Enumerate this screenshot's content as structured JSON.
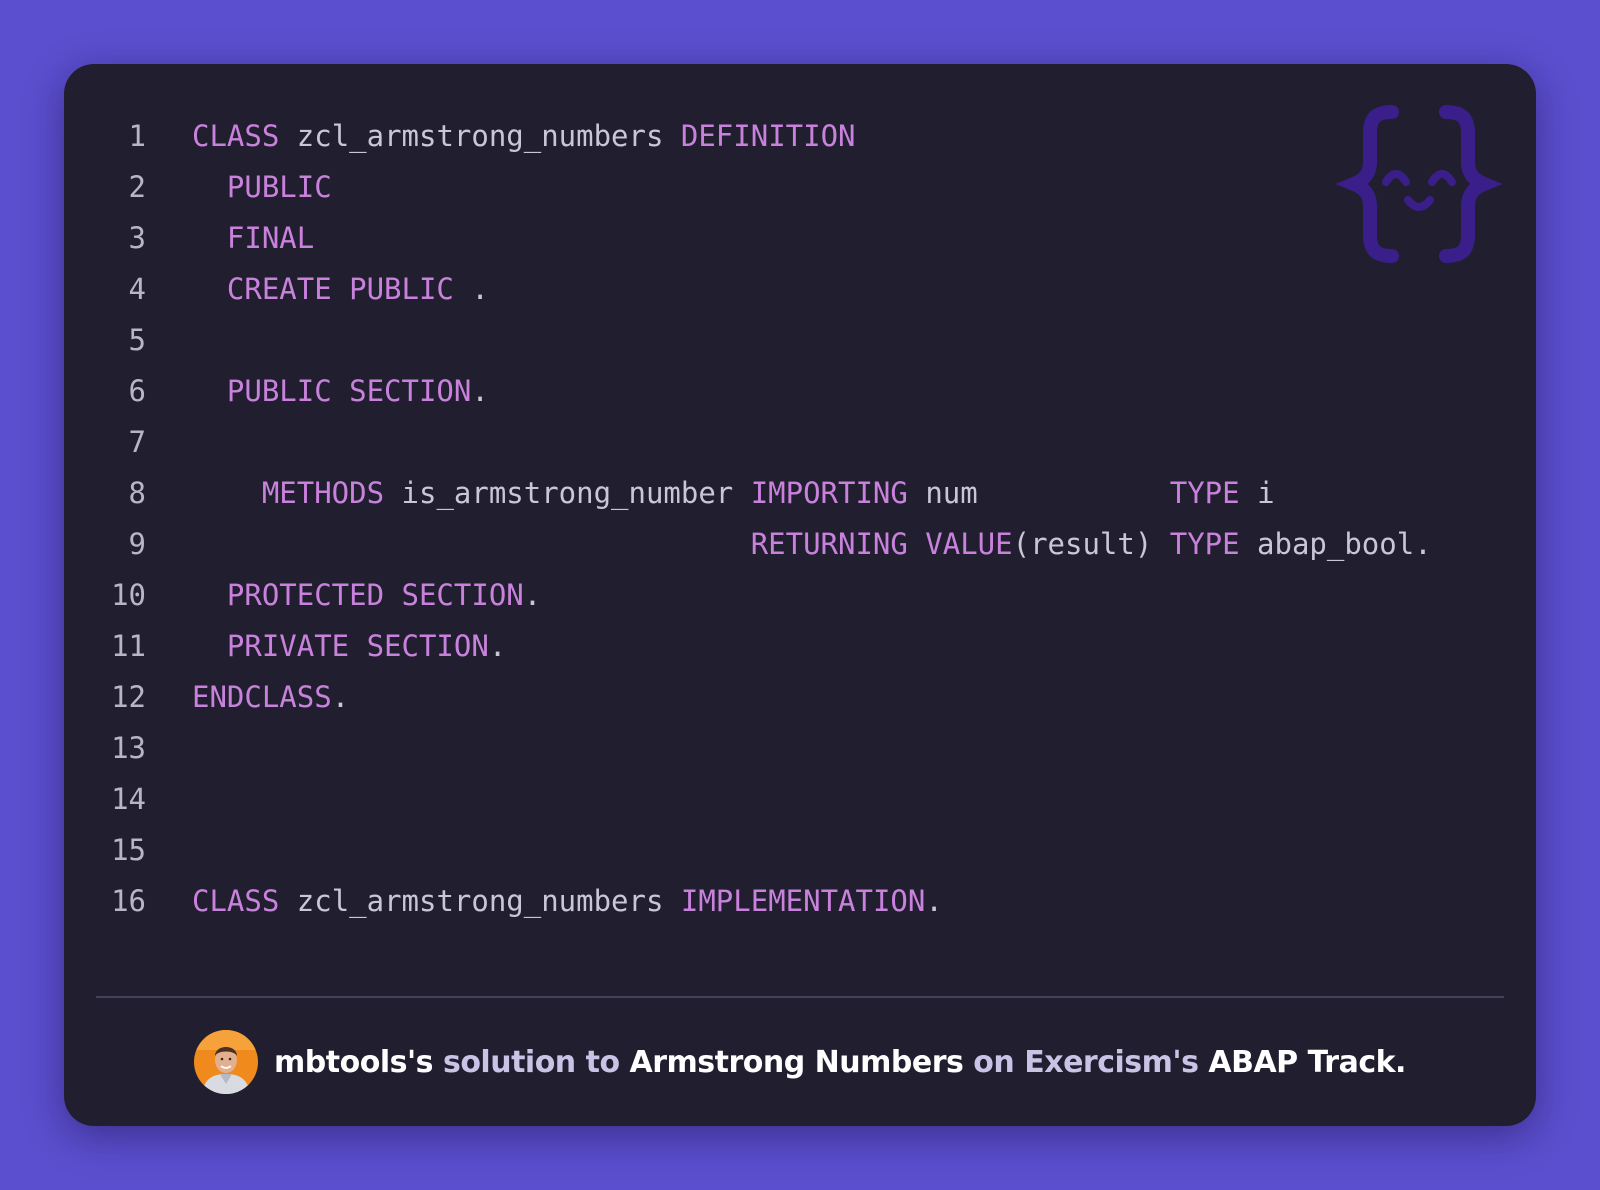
{
  "colors": {
    "background": "#5b4fcf",
    "card": "#211e30",
    "keyword": "#c882dc",
    "identifier": "#c9c6d6",
    "line_number": "#b8b6c6",
    "divider": "#45425a"
  },
  "logo": {
    "icon": "exercism-curly-brace-face-icon"
  },
  "code": {
    "language": "ABAP",
    "lines": [
      {
        "number": "1",
        "tokens": [
          {
            "t": "kw",
            "v": "CLASS"
          },
          {
            "t": "id",
            "v": " zcl_armstrong_numbers "
          },
          {
            "t": "kw",
            "v": "DEFINITION"
          }
        ]
      },
      {
        "number": "2",
        "tokens": [
          {
            "t": "id",
            "v": "  "
          },
          {
            "t": "kw",
            "v": "PUBLIC"
          }
        ]
      },
      {
        "number": "3",
        "tokens": [
          {
            "t": "id",
            "v": "  "
          },
          {
            "t": "kw",
            "v": "FINAL"
          }
        ]
      },
      {
        "number": "4",
        "tokens": [
          {
            "t": "id",
            "v": "  "
          },
          {
            "t": "kw",
            "v": "CREATE PUBLIC"
          },
          {
            "t": "id",
            "v": " ."
          }
        ]
      },
      {
        "number": "5",
        "tokens": []
      },
      {
        "number": "6",
        "tokens": [
          {
            "t": "id",
            "v": "  "
          },
          {
            "t": "kw",
            "v": "PUBLIC SECTION"
          },
          {
            "t": "id",
            "v": "."
          }
        ]
      },
      {
        "number": "7",
        "tokens": []
      },
      {
        "number": "8",
        "tokens": [
          {
            "t": "id",
            "v": "    "
          },
          {
            "t": "kw",
            "v": "METHODS"
          },
          {
            "t": "id",
            "v": " is_armstrong_number "
          },
          {
            "t": "kw",
            "v": "IMPORTING"
          },
          {
            "t": "id",
            "v": " num           "
          },
          {
            "t": "kw",
            "v": "TYPE"
          },
          {
            "t": "id",
            "v": " i"
          }
        ]
      },
      {
        "number": "9",
        "tokens": [
          {
            "t": "id",
            "v": "                                "
          },
          {
            "t": "kw",
            "v": "RETURNING VALUE"
          },
          {
            "t": "id",
            "v": "(result) "
          },
          {
            "t": "kw",
            "v": "TYPE"
          },
          {
            "t": "id",
            "v": " abap_bool."
          }
        ]
      },
      {
        "number": "10",
        "tokens": [
          {
            "t": "id",
            "v": "  "
          },
          {
            "t": "kw",
            "v": "PROTECTED SECTION"
          },
          {
            "t": "id",
            "v": "."
          }
        ]
      },
      {
        "number": "11",
        "tokens": [
          {
            "t": "id",
            "v": "  "
          },
          {
            "t": "kw",
            "v": "PRIVATE SECTION"
          },
          {
            "t": "id",
            "v": "."
          }
        ]
      },
      {
        "number": "12",
        "tokens": [
          {
            "t": "kw",
            "v": "ENDCLASS"
          },
          {
            "t": "id",
            "v": "."
          }
        ]
      },
      {
        "number": "13",
        "tokens": []
      },
      {
        "number": "14",
        "tokens": []
      },
      {
        "number": "15",
        "tokens": []
      },
      {
        "number": "16",
        "tokens": [
          {
            "t": "kw",
            "v": "CLASS"
          },
          {
            "t": "id",
            "v": " zcl_armstrong_numbers "
          },
          {
            "t": "kw",
            "v": "IMPLEMENTATION"
          },
          {
            "t": "id",
            "v": "."
          }
        ]
      }
    ]
  },
  "footer": {
    "avatar_icon": "user-avatar-icon",
    "author": "mbtools's",
    "text_solution_to": " solution to ",
    "exercise": "Armstrong Numbers",
    "text_on": " on ",
    "site": "Exercism's",
    "track": " ABAP Track."
  }
}
